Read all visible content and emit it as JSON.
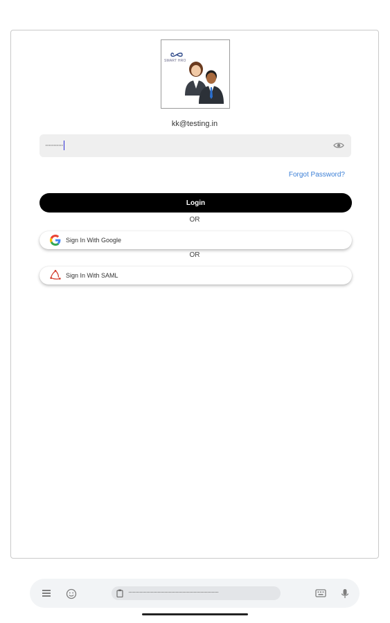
{
  "account": {
    "email": "kk@testing.in",
    "brand_text": "SMART HRO"
  },
  "password": {
    "masked_value": "···········"
  },
  "links": {
    "forgot_password": "Forgot Password?"
  },
  "buttons": {
    "login": "Login",
    "or_1": "OR",
    "google": "Sign In With Google",
    "or_2": "OR",
    "saml": "Sign In With SAML"
  },
  "keyboard": {
    "clipboard_text": "·································································"
  },
  "colors": {
    "link": "#3b7fd6",
    "primary_button": "#000000",
    "field_bg": "#efefef"
  }
}
